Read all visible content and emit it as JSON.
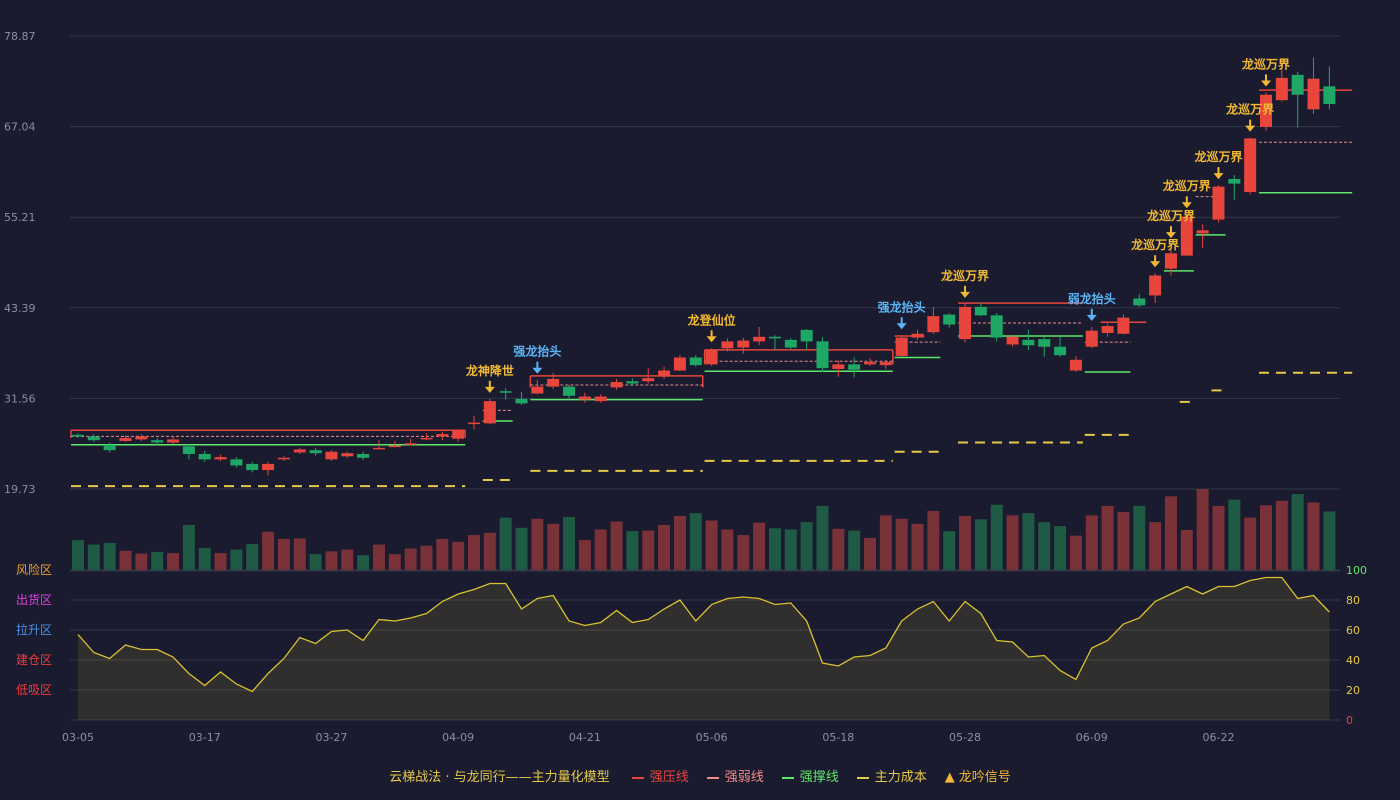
{
  "chart_data": {
    "type": "candlestick",
    "price_axis": {
      "ticks": [
        "78.87",
        "67.04",
        "55.21",
        "43.39",
        "31.56",
        "19.73"
      ],
      "ylim": [
        19.73,
        78.87
      ]
    },
    "x_ticks": [
      {
        "idx": 0,
        "label": "03-05"
      },
      {
        "idx": 8,
        "label": "03-17"
      },
      {
        "idx": 16,
        "label": "03-27"
      },
      {
        "idx": 24,
        "label": "04-09"
      },
      {
        "idx": 32,
        "label": "04-21"
      },
      {
        "idx": 40,
        "label": "05-06"
      },
      {
        "idx": 48,
        "label": "05-18"
      },
      {
        "idx": 56,
        "label": "05-28"
      },
      {
        "idx": 64,
        "label": "06-09"
      },
      {
        "idx": 72,
        "label": "06-22"
      }
    ],
    "colors": {
      "up": "#e8453c",
      "down": "#1fa865",
      "vol_up": "#7a3138",
      "vol_down": "#1e5a44",
      "pressure": "#e8453c",
      "weak": "#f08a8a",
      "support": "#5de86a",
      "cost": "#e6c84a",
      "signal_gold": "#f2b933",
      "signal_blue": "#5ab4f5",
      "osc": "#d9c230"
    },
    "candles": [
      [
        26.8,
        26.6,
        27.0,
        26.4
      ],
      [
        26.6,
        26.1,
        26.9,
        25.9
      ],
      [
        25.5,
        24.8,
        25.8,
        24.5
      ],
      [
        26.0,
        26.4,
        26.7,
        25.9
      ],
      [
        26.2,
        26.6,
        26.9,
        26.0
      ],
      [
        26.1,
        25.8,
        26.4,
        25.5
      ],
      [
        25.8,
        26.2,
        26.6,
        25.6
      ],
      [
        25.3,
        24.3,
        25.6,
        23.6
      ],
      [
        24.3,
        23.6,
        24.7,
        23.3
      ],
      [
        23.6,
        23.9,
        24.2,
        23.4
      ],
      [
        23.6,
        22.8,
        23.9,
        22.5
      ],
      [
        23.0,
        22.2,
        23.3,
        21.9
      ],
      [
        22.2,
        23.0,
        23.3,
        21.5
      ],
      [
        23.6,
        23.8,
        24.0,
        23.4
      ],
      [
        24.5,
        24.9,
        25.1,
        24.3
      ],
      [
        24.8,
        24.4,
        25.1,
        24.1
      ],
      [
        23.6,
        24.6,
        24.8,
        23.4
      ],
      [
        24.0,
        24.4,
        24.6,
        23.8
      ],
      [
        24.3,
        23.8,
        24.6,
        23.5
      ],
      [
        25.0,
        25.1,
        26.1,
        24.9
      ],
      [
        25.4,
        25.4,
        26.0,
        25.2
      ],
      [
        25.6,
        25.7,
        26.3,
        25.4
      ],
      [
        26.3,
        26.4,
        27.0,
        26.1
      ],
      [
        26.6,
        26.9,
        27.2,
        26.1
      ],
      [
        26.3,
        27.4,
        27.5,
        25.9
      ],
      [
        28.3,
        28.4,
        29.3,
        27.5
      ],
      [
        28.3,
        31.2,
        31.5,
        28.2
      ],
      [
        32.5,
        32.3,
        32.9,
        31.4
      ],
      [
        31.5,
        30.9,
        32.4,
        30.7
      ],
      [
        32.2,
        33.1,
        34.0,
        32.1
      ],
      [
        33.1,
        34.1,
        34.9,
        32.8
      ],
      [
        33.1,
        31.9,
        33.3,
        31.6
      ],
      [
        31.4,
        31.8,
        32.3,
        31.0
      ],
      [
        31.2,
        31.8,
        32.1,
        31.0
      ],
      [
        33.0,
        33.7,
        34.1,
        32.7
      ],
      [
        33.8,
        33.5,
        34.2,
        33.2
      ],
      [
        33.8,
        34.2,
        35.5,
        33.5
      ],
      [
        34.4,
        35.2,
        35.7,
        34.1
      ],
      [
        35.2,
        36.9,
        37.2,
        35.1
      ],
      [
        36.9,
        35.9,
        37.2,
        35.7
      ],
      [
        36.0,
        37.9,
        38.1,
        35.8
      ],
      [
        38.1,
        39.0,
        39.4,
        37.7
      ],
      [
        38.2,
        39.1,
        39.5,
        37.4
      ],
      [
        39.0,
        39.6,
        40.9,
        38.5
      ],
      [
        39.6,
        39.4,
        39.8,
        37.9
      ],
      [
        39.2,
        38.2,
        39.4,
        38.0
      ],
      [
        40.5,
        39.0,
        40.6,
        37.9
      ],
      [
        39.0,
        35.5,
        39.6,
        35.0
      ],
      [
        35.4,
        36.0,
        36.5,
        34.4
      ],
      [
        36.0,
        35.3,
        36.9,
        34.3
      ],
      [
        36.0,
        36.3,
        36.8,
        35.8
      ],
      [
        35.9,
        36.3,
        36.6,
        35.4
      ],
      [
        37.1,
        39.5,
        39.8,
        37.0
      ],
      [
        39.5,
        40.0,
        40.5,
        39.2
      ],
      [
        40.2,
        42.3,
        43.5,
        40.0
      ],
      [
        42.5,
        41.2,
        42.7,
        40.8
      ],
      [
        39.3,
        43.5,
        43.9,
        38.9
      ],
      [
        43.5,
        42.4,
        44.1,
        42.3
      ],
      [
        42.4,
        39.5,
        42.7,
        39.0
      ],
      [
        38.6,
        39.6,
        39.8,
        38.3
      ],
      [
        39.2,
        38.5,
        40.5,
        37.9
      ],
      [
        39.3,
        38.3,
        39.6,
        37.0
      ],
      [
        38.3,
        37.2,
        39.6,
        37.0
      ],
      [
        35.2,
        36.6,
        37.1,
        35.0
      ],
      [
        38.3,
        40.4,
        40.9,
        38.1
      ],
      [
        40.1,
        41.0,
        41.3,
        39.6
      ],
      [
        40.0,
        42.1,
        42.5,
        39.9
      ],
      [
        44.6,
        43.7,
        45.2,
        43.5
      ],
      [
        45.0,
        47.6,
        47.9,
        44.0
      ],
      [
        48.5,
        50.5,
        51.7,
        47.6
      ],
      [
        50.2,
        55.3,
        55.6,
        50.1
      ],
      [
        53.1,
        53.5,
        54.3,
        51.2
      ],
      [
        54.9,
        59.2,
        59.4,
        54.5
      ],
      [
        60.2,
        59.6,
        60.7,
        57.5
      ],
      [
        58.5,
        65.5,
        65.6,
        58.2
      ],
      [
        67.0,
        71.2,
        71.5,
        66.5
      ],
      [
        70.5,
        73.4,
        76.0,
        70.3
      ],
      [
        73.8,
        71.2,
        74.2,
        66.9
      ],
      [
        69.3,
        73.3,
        76.1,
        68.7
      ],
      [
        72.3,
        70.0,
        74.9,
        69.3
      ]
    ],
    "volume": [
      0.55,
      0.47,
      0.5,
      0.36,
      0.31,
      0.34,
      0.32,
      0.82,
      0.41,
      0.32,
      0.38,
      0.48,
      0.7,
      0.57,
      0.58,
      0.3,
      0.35,
      0.38,
      0.28,
      0.47,
      0.3,
      0.4,
      0.45,
      0.57,
      0.52,
      0.64,
      0.68,
      0.95,
      0.77,
      0.93,
      0.84,
      0.96,
      0.55,
      0.74,
      0.88,
      0.71,
      0.72,
      0.82,
      0.98,
      1.03,
      0.9,
      0.74,
      0.64,
      0.86,
      0.76,
      0.74,
      0.87,
      1.16,
      0.75,
      0.72,
      0.59,
      0.99,
      0.93,
      0.84,
      1.07,
      0.71,
      0.98,
      0.92,
      1.18,
      0.99,
      1.03,
      0.87,
      0.8,
      0.63,
      0.99,
      1.16,
      1.05,
      1.16,
      0.87,
      1.33,
      0.73,
      1.46,
      1.16,
      1.27,
      0.95,
      1.17,
      1.25,
      1.37,
      1.22,
      1.06
    ],
    "oscillator": {
      "ticks": [
        "100",
        "80",
        "60",
        "40",
        "20",
        "0"
      ],
      "zones": [
        "风险区",
        "出货区",
        "拉升区",
        "建仓区",
        "低吸区"
      ],
      "values": [
        57,
        45,
        41,
        50,
        47,
        47,
        42,
        31,
        23,
        32,
        24,
        19,
        31,
        41,
        55,
        51,
        59,
        60,
        53,
        67,
        66,
        68,
        71,
        79,
        84,
        87,
        91,
        91,
        74,
        81,
        83,
        66,
        63,
        65,
        73,
        65,
        67,
        74,
        80,
        66,
        77,
        81,
        82,
        81,
        77,
        78,
        66,
        38,
        36,
        42,
        43,
        48,
        66,
        74,
        79,
        66,
        79,
        71,
        53,
        52,
        42,
        43,
        33,
        27,
        48,
        53,
        64,
        68,
        79,
        84,
        89,
        84,
        89,
        89,
        93,
        95,
        95,
        81,
        83,
        72
      ]
    },
    "pressure_lines": [
      {
        "x0": 0,
        "x1": 24,
        "y": 27.4,
        "rect_bottom": 26.4
      },
      {
        "x0": 29,
        "x1": 39,
        "y": 34.5,
        "rect_bottom": 33.0
      },
      {
        "x0": 40,
        "x1": 51,
        "y": 37.9,
        "rect_bottom": 36.0
      },
      {
        "x0": 52,
        "x1": 53,
        "y": 39.7
      },
      {
        "x0": 56,
        "x1": 63,
        "y": 44.0
      },
      {
        "x0": 65,
        "x1": 67,
        "y": 41.5
      },
      {
        "x0": 75,
        "x1": 80,
        "y": 71.8
      }
    ],
    "weak_lines": [
      {
        "x0": 0,
        "x1": 24,
        "y": 26.6
      },
      {
        "x0": 26,
        "x1": 27,
        "y": 30.0
      },
      {
        "x0": 29,
        "x1": 39,
        "y": 33.3
      },
      {
        "x0": 40,
        "x1": 51,
        "y": 36.4
      },
      {
        "x0": 52,
        "x1": 54,
        "y": 38.9
      },
      {
        "x0": 56,
        "x1": 63,
        "y": 41.4
      },
      {
        "x0": 64,
        "x1": 66,
        "y": 38.9
      },
      {
        "x0": 71,
        "x1": 72,
        "y": 57.9
      },
      {
        "x0": 75,
        "x1": 80,
        "y": 65.0
      }
    ],
    "support_lines": [
      {
        "x0": 0,
        "x1": 24,
        "y": 25.5
      },
      {
        "x0": 26,
        "x1": 27,
        "y": 28.6
      },
      {
        "x0": 29,
        "x1": 39,
        "y": 31.4
      },
      {
        "x0": 40,
        "x1": 51,
        "y": 35.1
      },
      {
        "x0": 52,
        "x1": 54,
        "y": 36.9
      },
      {
        "x0": 56,
        "x1": 63,
        "y": 39.7
      },
      {
        "x0": 64,
        "x1": 66,
        "y": 35.0
      },
      {
        "x0": 69,
        "x1": 70,
        "y": 48.2
      },
      {
        "x0": 71,
        "x1": 72,
        "y": 52.9
      },
      {
        "x0": 75,
        "x1": 80,
        "y": 58.4
      }
    ],
    "cost_lines": [
      {
        "x0": 0,
        "x1": 24,
        "y": 20.1
      },
      {
        "x0": 26,
        "x1": 27,
        "y": 20.9
      },
      {
        "x0": 29,
        "x1": 39,
        "y": 22.1
      },
      {
        "x0": 40,
        "x1": 51,
        "y": 23.4
      },
      {
        "x0": 52,
        "x1": 54,
        "y": 24.6
      },
      {
        "x0": 56,
        "x1": 63,
        "y": 25.8
      },
      {
        "x0": 64,
        "x1": 66,
        "y": 26.8
      },
      {
        "x0": 70,
        "x1": 70,
        "y": 31.1
      },
      {
        "x0": 72,
        "x1": 72,
        "y": 32.6
      },
      {
        "x0": 75,
        "x1": 80,
        "y": 34.9
      }
    ],
    "signals": [
      {
        "idx": 26,
        "label": "龙神降世",
        "color": "gold"
      },
      {
        "idx": 29,
        "label": "强龙抬头",
        "color": "blue"
      },
      {
        "idx": 40,
        "label": "龙登仙位",
        "color": "gold"
      },
      {
        "idx": 52,
        "label": "强龙抬头",
        "color": "blue"
      },
      {
        "idx": 56,
        "label": "龙巡万界",
        "color": "gold"
      },
      {
        "idx": 64,
        "label": "弱龙抬头",
        "color": "blue"
      },
      {
        "idx": 68,
        "label": "龙巡万界",
        "color": "gold"
      },
      {
        "idx": 69,
        "label": "龙巡万界",
        "color": "gold"
      },
      {
        "idx": 70,
        "label": "龙巡万界",
        "color": "gold"
      },
      {
        "idx": 72,
        "label": "龙巡万界",
        "color": "gold"
      },
      {
        "idx": 74,
        "label": "龙巡万界",
        "color": "gold"
      },
      {
        "idx": 75,
        "label": "龙巡万界",
        "color": "gold"
      }
    ]
  },
  "legend": {
    "title": "云梯战法 · 与龙同行——主力量化模型",
    "items": [
      {
        "label": "强压线",
        "color": "#e8453c",
        "style": "solid"
      },
      {
        "label": "强弱线",
        "color": "#f08a8a",
        "style": "dashed"
      },
      {
        "label": "强撑线",
        "color": "#5de86a",
        "style": "solid"
      },
      {
        "label": "主力成本",
        "color": "#e6c84a",
        "style": "dashed"
      },
      {
        "label": "龙吟信号",
        "color": "#f2b933",
        "style": "triangle"
      }
    ]
  }
}
